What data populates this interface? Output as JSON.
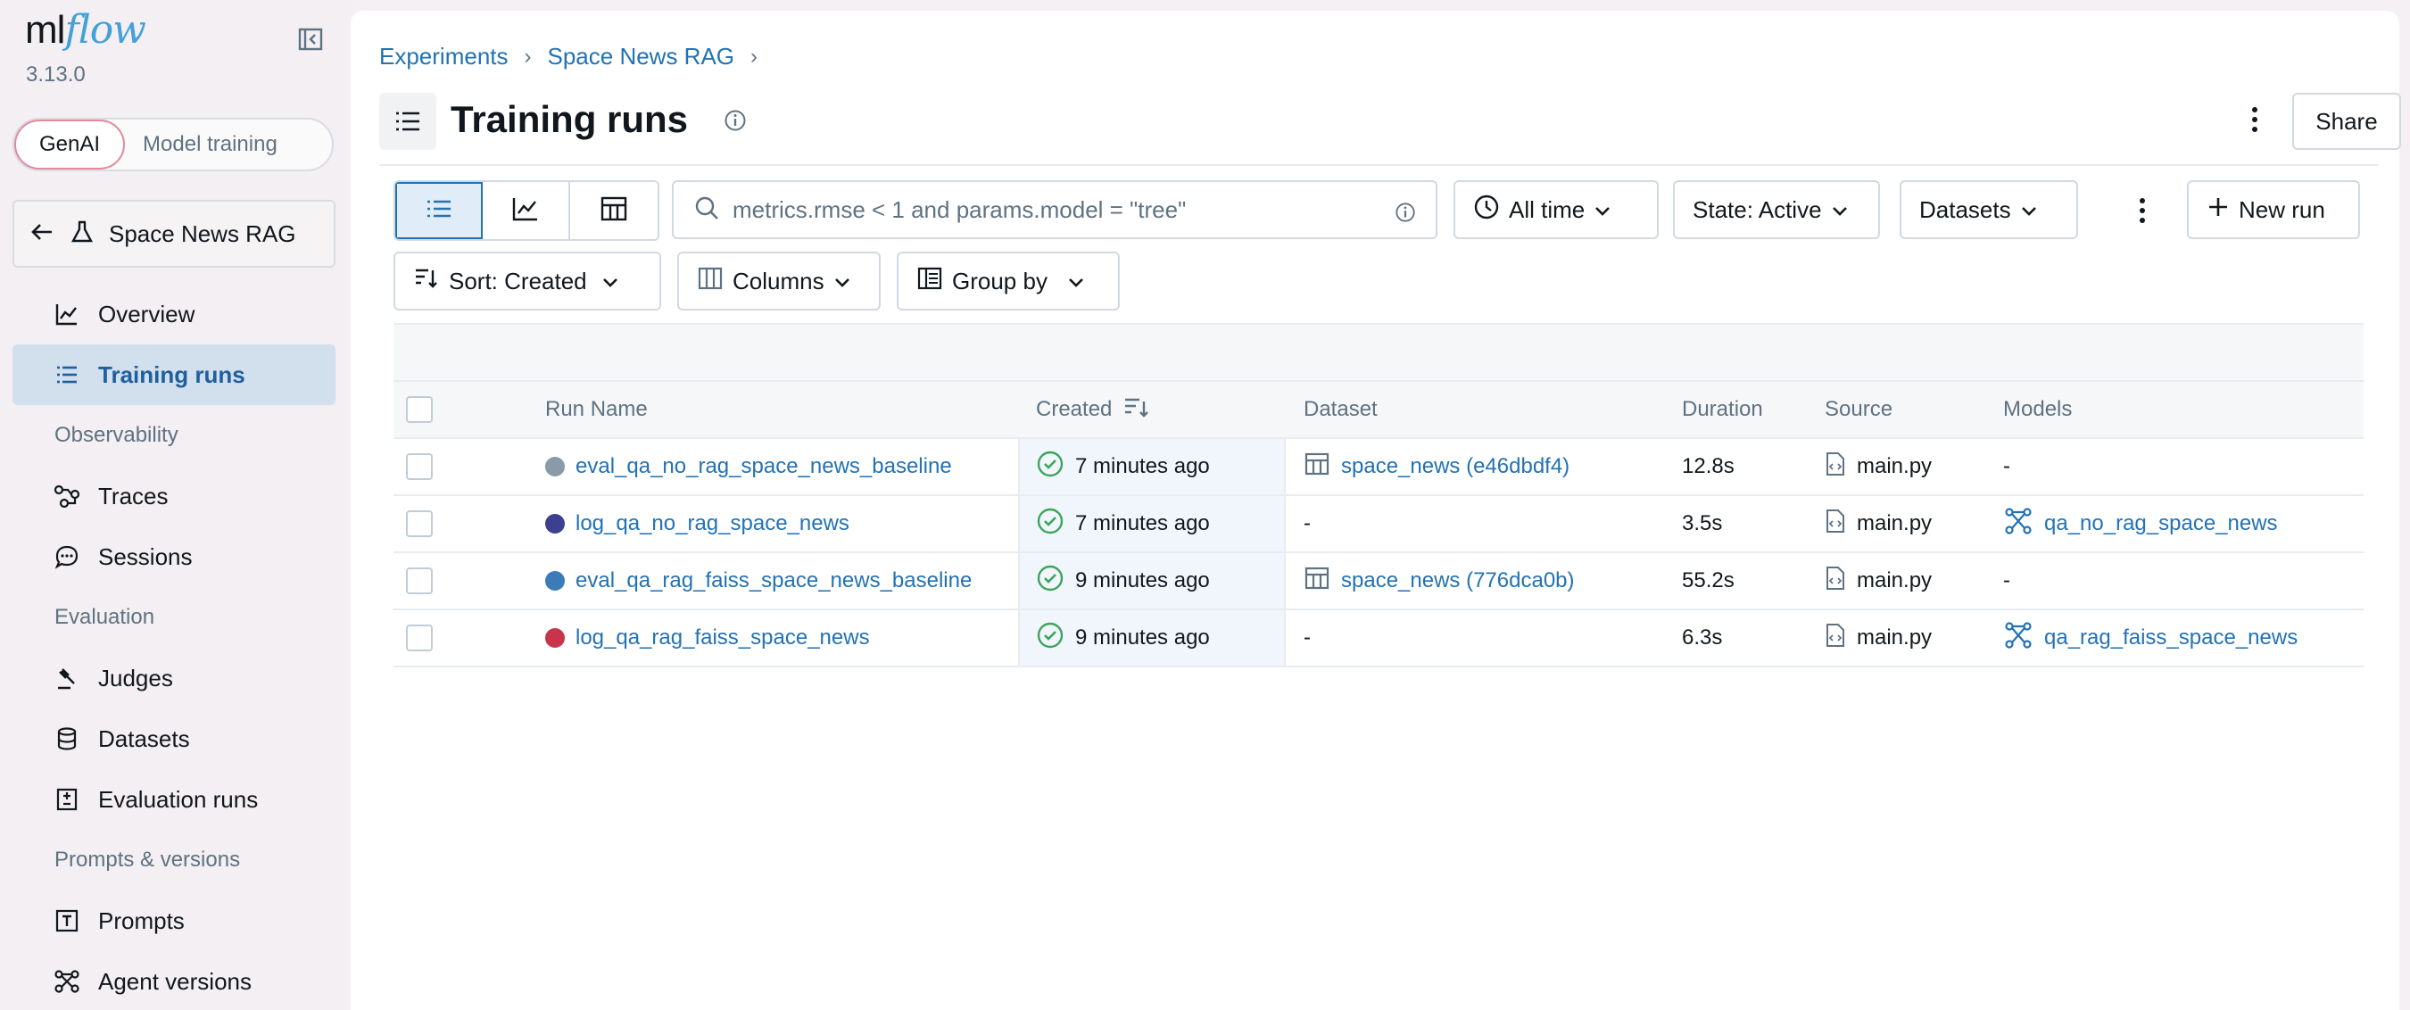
{
  "app": {
    "logo_ml": "ml",
    "logo_flow": "flow",
    "version": "3.13.0"
  },
  "toggle": {
    "genai": "GenAI",
    "model_training": "Model training"
  },
  "experiment_back": {
    "label": "Space News RAG"
  },
  "sidebar": {
    "items": [
      {
        "label": "Overview",
        "icon": "chart-line-icon"
      },
      {
        "label": "Training runs",
        "icon": "list-icon"
      },
      {
        "section": "Observability"
      },
      {
        "label": "Traces",
        "icon": "traces-icon"
      },
      {
        "label": "Sessions",
        "icon": "chat-bubble-icon"
      },
      {
        "section": "Evaluation"
      },
      {
        "label": "Judges",
        "icon": "gavel-icon"
      },
      {
        "label": "Datasets",
        "icon": "database-icon"
      },
      {
        "label": "Evaluation runs",
        "icon": "evaluation-icon"
      },
      {
        "section": "Prompts & versions"
      },
      {
        "label": "Prompts",
        "icon": "prompt-icon"
      },
      {
        "label": "Agent versions",
        "icon": "agent-icon"
      }
    ]
  },
  "breadcrumb": {
    "experiments": "Experiments",
    "experiment": "Space News RAG",
    "sep": "›"
  },
  "header": {
    "title": "Training runs",
    "share": "Share"
  },
  "toolbar": {
    "search_placeholder": "metrics.rmse < 1 and params.model = \"tree\"",
    "time": "All time",
    "state": "State: Active",
    "datasets": "Datasets",
    "new_run": "New run",
    "sort": "Sort: Created",
    "columns": "Columns",
    "group_by": "Group by"
  },
  "table": {
    "columns": {
      "run_name": "Run Name",
      "created": "Created",
      "dataset": "Dataset",
      "duration": "Duration",
      "source": "Source",
      "models": "Models"
    },
    "rows": [
      {
        "name": "eval_qa_no_rag_space_news_baseline",
        "color": "#8a9aa8",
        "created": "7 minutes ago",
        "dataset": "space_news (e46dbdf4)",
        "duration": "12.8s",
        "source": "main.py",
        "model": "-"
      },
      {
        "name": "log_qa_no_rag_space_news",
        "color": "#3d3f8f",
        "created": "7 minutes ago",
        "dataset": "-",
        "duration": "3.5s",
        "source": "main.py",
        "model": "qa_no_rag_space_news"
      },
      {
        "name": "eval_qa_rag_faiss_space_news_baseline",
        "color": "#3a7bb8",
        "created": "9 minutes ago",
        "dataset": "space_news (776dca0b)",
        "duration": "55.2s",
        "source": "main.py",
        "model": "-"
      },
      {
        "name": "log_qa_rag_faiss_space_news",
        "color": "#c8344a",
        "created": "9 minutes ago",
        "dataset": "-",
        "duration": "6.3s",
        "source": "main.py",
        "model": "qa_rag_faiss_space_news"
      }
    ]
  },
  "colors": {
    "accent": "#2272b4",
    "success": "#3ba55c",
    "active_nav_bg": "#d2dfec"
  }
}
